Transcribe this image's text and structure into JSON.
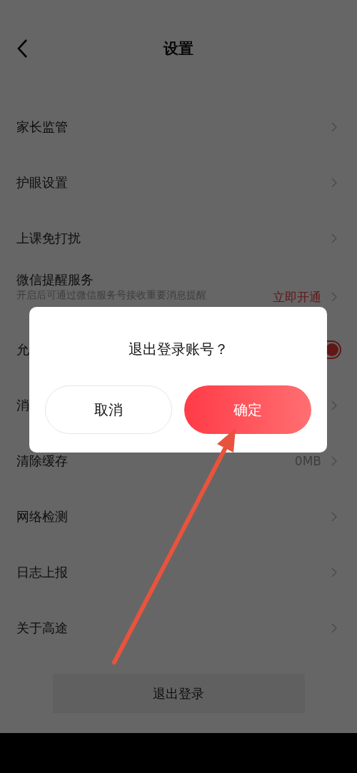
{
  "header": {
    "title": "设置"
  },
  "rows": [
    {
      "kind": "link",
      "label": "家长监管"
    },
    {
      "kind": "link",
      "label": "护眼设置"
    },
    {
      "kind": "link",
      "label": "上课免打扰"
    },
    {
      "kind": "promo",
      "label": "微信提醒服务",
      "subtitle": "开启后可通过微信服务号接收重要消息提醒",
      "value": "立即开通"
    },
    {
      "kind": "toggle",
      "label": "允",
      "on": true
    },
    {
      "kind": "link",
      "label": "消"
    },
    {
      "kind": "link",
      "label": "清除缓存",
      "value": "0MB"
    },
    {
      "kind": "link",
      "label": "网络检测"
    },
    {
      "kind": "link",
      "label": "日志上报"
    },
    {
      "kind": "link",
      "label": "关于高途"
    }
  ],
  "logout_button": "退出登录",
  "dialog": {
    "title": "退出登录账号？",
    "buttons": [
      {
        "label": "取消",
        "kind": "secondary"
      },
      {
        "label": "确定",
        "kind": "primary"
      }
    ]
  }
}
